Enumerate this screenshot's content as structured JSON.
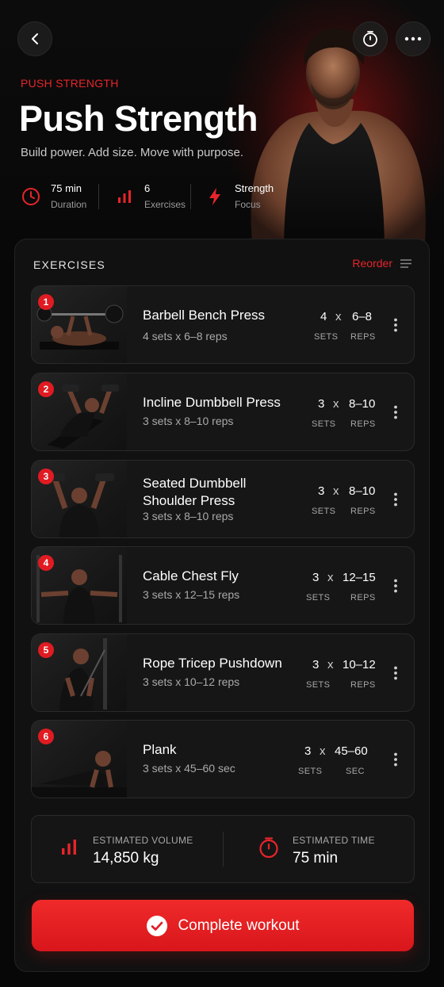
{
  "header": {
    "eyebrow": "PUSH STRENGTH",
    "title": "Push Strength",
    "subtitle": "Build power. Add size. Move with purpose.",
    "stats": [
      {
        "value": "75 min",
        "label": "Duration",
        "icon": "clock-icon"
      },
      {
        "value": "6",
        "label": "Exercises",
        "icon": "bar-chart-icon"
      },
      {
        "value": "Strength",
        "label": "Focus",
        "icon": "lightning-icon"
      }
    ]
  },
  "section": {
    "title": "EXERCISES",
    "reorder_label": "Reorder"
  },
  "exercises": [
    {
      "num": "1",
      "name": "Barbell Bench Press",
      "detail": "4 sets x 6–8 reps",
      "sets": "4",
      "x": "x",
      "reps": "6–8",
      "sets_label": "SETS",
      "reps_label": "REPS"
    },
    {
      "num": "2",
      "name": "Incline Dumbbell Press",
      "detail": "3 sets x 8–10 reps",
      "sets": "3",
      "x": "x",
      "reps": "8–10",
      "sets_label": "SETS",
      "reps_label": "REPS"
    },
    {
      "num": "3",
      "name": "Seated Dumbbell Shoulder Press",
      "detail": "3 sets x 8–10 reps",
      "sets": "3",
      "x": "x",
      "reps": "8–10",
      "sets_label": "SETS",
      "reps_label": "REPS"
    },
    {
      "num": "4",
      "name": "Cable Chest Fly",
      "detail": "3 sets x 12–15 reps",
      "sets": "3",
      "x": "x",
      "reps": "12–15",
      "sets_label": "SETS",
      "reps_label": "REPS"
    },
    {
      "num": "5",
      "name": "Rope Tricep Pushdown",
      "detail": "3 sets x 10–12 reps",
      "sets": "3",
      "x": "x",
      "reps": "10–12",
      "sets_label": "SETS",
      "reps_label": "REPS"
    },
    {
      "num": "6",
      "name": "Plank",
      "detail": "3 sets x 45–60 sec",
      "sets": "3",
      "x": "x",
      "reps": "45–60",
      "sets_label": "SETS",
      "reps_label": "SEC"
    }
  ],
  "summary": {
    "volume_label": "ESTIMATED VOLUME",
    "volume_value": "14,850 kg",
    "time_label": "ESTIMATED TIME",
    "time_value": "75 min"
  },
  "cta": {
    "label": "Complete workout"
  },
  "colors": {
    "accent": "#e8242a",
    "background": "#070707",
    "card": "#161616"
  }
}
